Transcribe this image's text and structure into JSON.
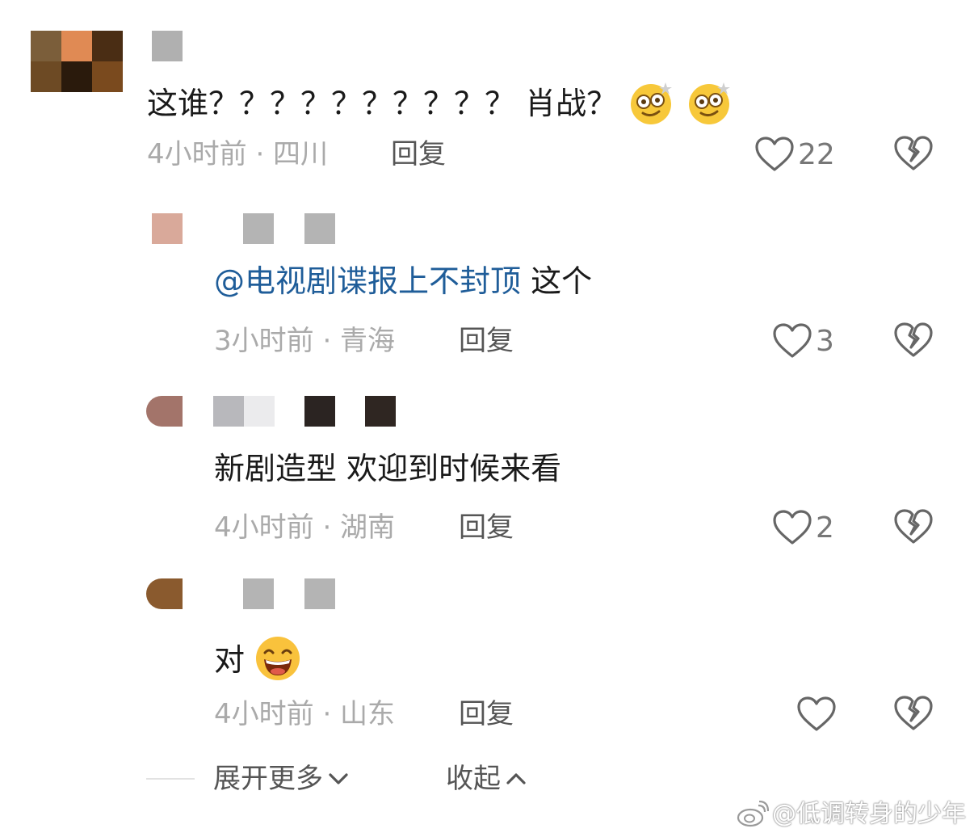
{
  "comments": [
    {
      "text_main": "这谁？？？？？？？？？？ 肖战？",
      "meta": "4小时前 · 四川",
      "reply_label": "回复",
      "like_count": "22",
      "emoji": [
        "dizzy-face-emoji",
        "dizzy-face-emoji"
      ]
    },
    {
      "mention": "@电视剧谍报上不封顶",
      "text_main": " 这个",
      "meta": "3小时前 · 青海",
      "reply_label": "回复",
      "like_count": "3"
    },
    {
      "text_main": "新剧造型 欢迎到时候来看",
      "meta": "4小时前 · 湖南",
      "reply_label": "回复",
      "like_count": "2"
    },
    {
      "text_main": "对",
      "meta": "4小时前 · 山东",
      "reply_label": "回复",
      "like_count": "",
      "emoji": [
        "grinning-face-emoji"
      ]
    }
  ],
  "footer": {
    "expand_label": "展开更多",
    "collapse_label": "收起"
  },
  "watermark": "@低调转身的少年",
  "colors": {
    "mention": "#1f5d99",
    "meta": "#aaaaaa",
    "icon": "#666666"
  }
}
